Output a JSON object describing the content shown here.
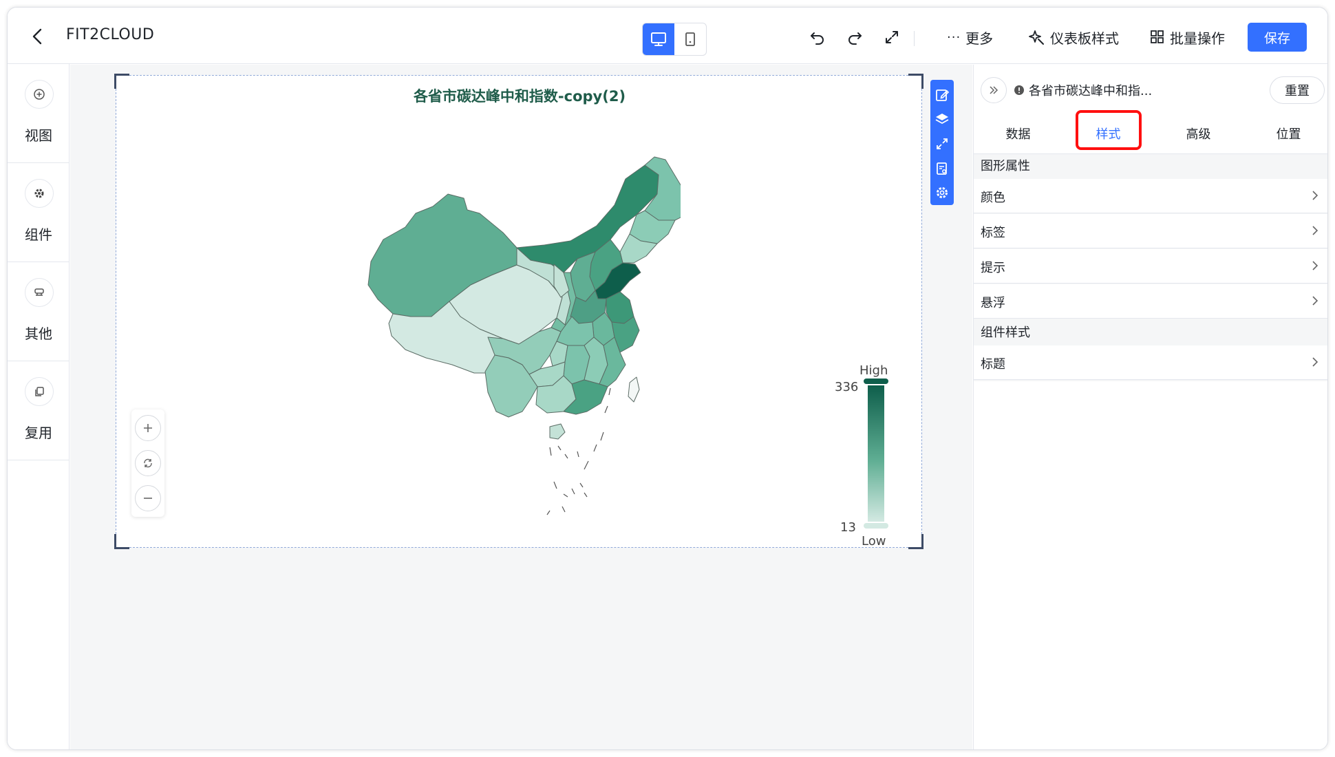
{
  "topbar": {
    "title": "FIT2CLOUD",
    "more_label": "更多",
    "dashboard_style_label": "仪表板样式",
    "batch_label": "批量操作",
    "save_label": "保存"
  },
  "sidebar": {
    "items": [
      {
        "label": "视图",
        "icon": "plus-circle-icon"
      },
      {
        "label": "组件",
        "icon": "gear-icon"
      },
      {
        "label": "其他",
        "icon": "stamp-icon"
      },
      {
        "label": "复用",
        "icon": "copy-icon"
      }
    ]
  },
  "chart": {
    "title": "各省市碳达峰中和指数-copy(2)"
  },
  "chart_data": {
    "type": "heatmap",
    "title": "各省市碳达峰中和指数-copy(2)",
    "legend": {
      "high_label": "High",
      "low_label": "Low",
      "max": 336,
      "min": 13,
      "placement": "bottom-right",
      "color_high": "#0e5e4b",
      "color_low": "#d3e9e2"
    }
  },
  "panel": {
    "title": "各省市碳达峰中和指...",
    "reset_label": "重置",
    "tabs": [
      {
        "label": "数据"
      },
      {
        "label": "样式"
      },
      {
        "label": "高级"
      },
      {
        "label": "位置"
      }
    ],
    "sections": [
      {
        "title": "图形属性",
        "rows": [
          {
            "label": "颜色"
          },
          {
            "label": "标签"
          },
          {
            "label": "提示"
          },
          {
            "label": "悬浮"
          }
        ]
      },
      {
        "title": "组件样式",
        "rows": [
          {
            "label": "标题"
          }
        ]
      }
    ]
  },
  "colors": {
    "accent": "#3370ff",
    "highlight_box": "#ff0f0f"
  }
}
